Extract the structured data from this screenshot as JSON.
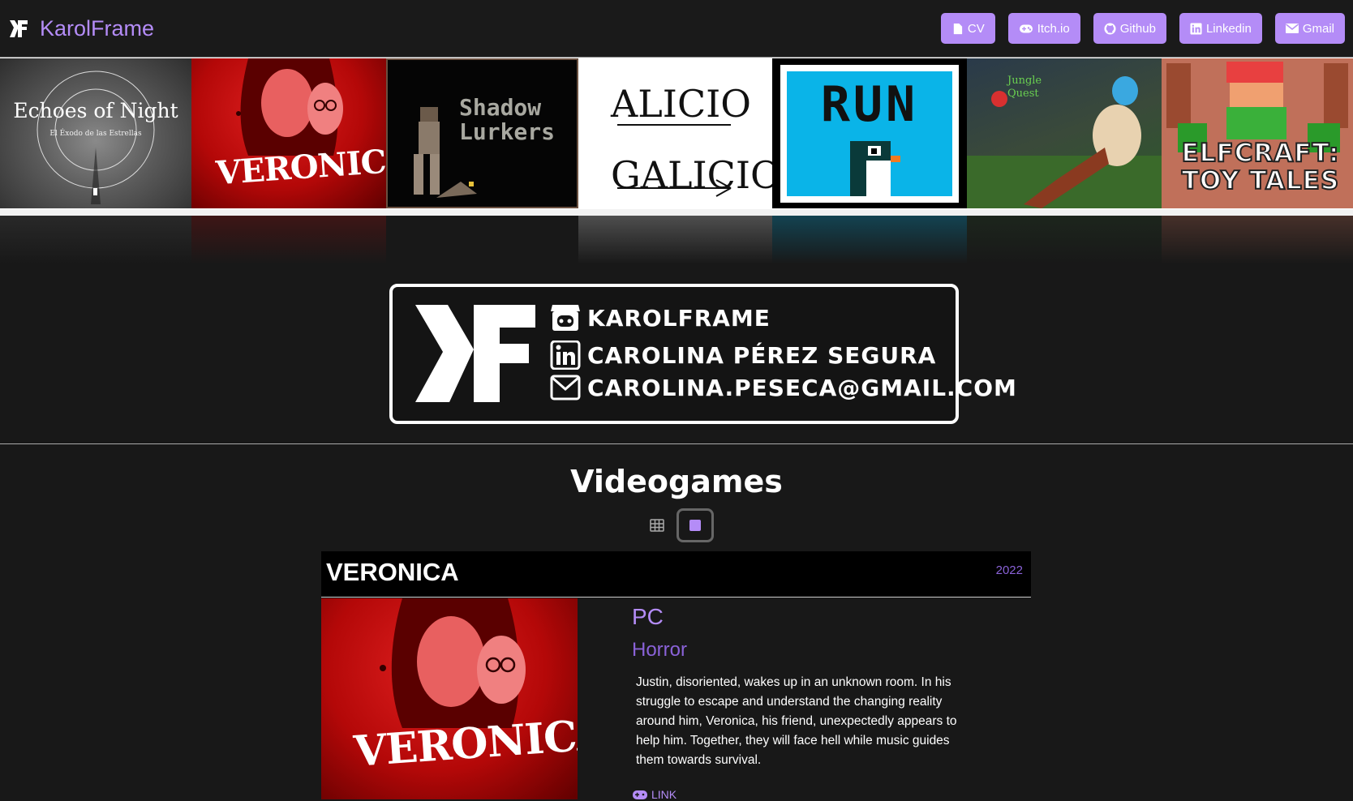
{
  "brand": {
    "name": "KarolFrame"
  },
  "nav": [
    {
      "label": "CV",
      "icon": "file-icon"
    },
    {
      "label": "Itch.io",
      "icon": "gamepad-icon"
    },
    {
      "label": "Github",
      "icon": "github-icon"
    },
    {
      "label": "Linkedin",
      "icon": "linkedin-icon"
    },
    {
      "label": "Gmail",
      "icon": "envelope-icon"
    }
  ],
  "strip": [
    {
      "title": "Echoes of Night",
      "subtitle": "El Éxodo de las Estrellas"
    },
    {
      "title": "VERONICA"
    },
    {
      "title": "Shadow Lurkers"
    },
    {
      "title": "ALICIO GALICIO"
    },
    {
      "title": "RUN"
    },
    {
      "title": "Jungle Quest"
    },
    {
      "title": "ELFCRAFT: TOY TALES"
    }
  ],
  "contact": {
    "handle": "KAROLFRAME",
    "name": "CAROLINA PÉREZ SEGURA",
    "email": "CAROLINA.PESECA@GMAIL.COM"
  },
  "section": {
    "title": "Videogames"
  },
  "game": {
    "title": "VERONICA",
    "year": "2022",
    "platform": "PC",
    "genre": "Horror",
    "description": "Justin, disoriented, wakes up in an unknown room. In his struggle to escape and understand the changing reality around him, Veronica, his friend, unexpectedly appears to help him. Together, they will face hell while music guides them towards survival.",
    "link_label": "LINK"
  },
  "colors": {
    "accent": "#b48cf7",
    "accent_dark": "#8a62d8",
    "background": "#181818"
  }
}
